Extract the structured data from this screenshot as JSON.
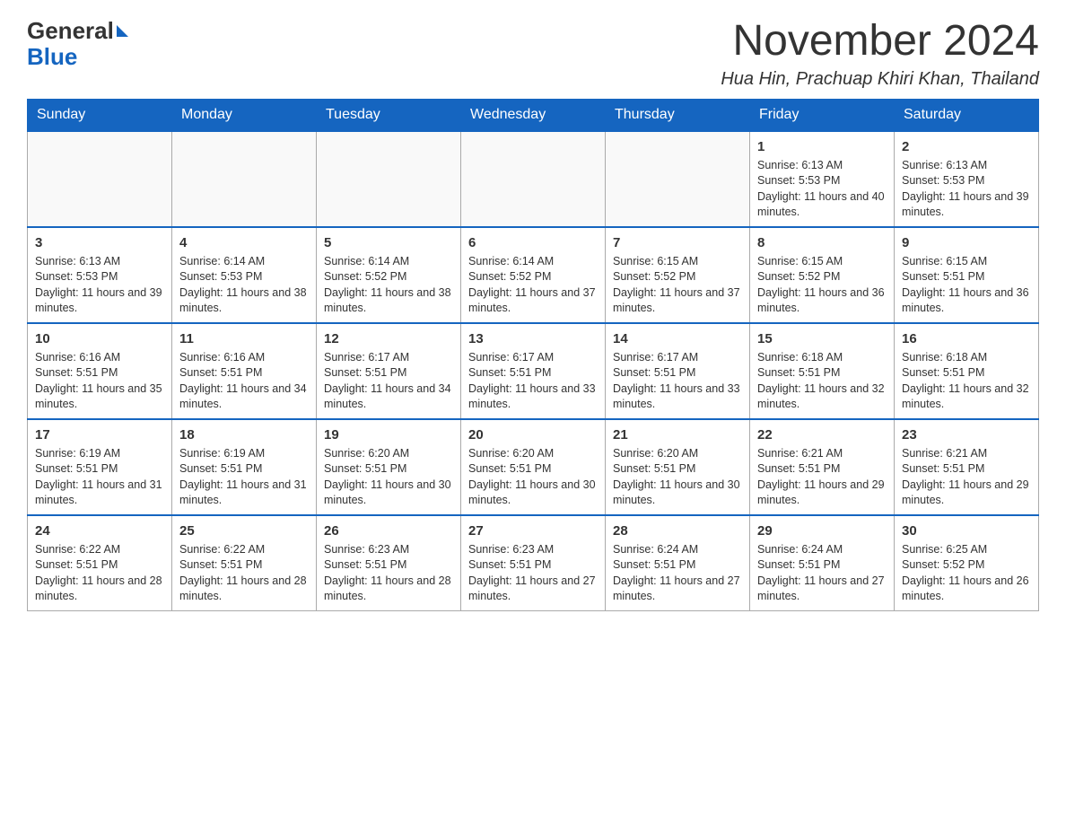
{
  "header": {
    "logo": {
      "general_text": "General",
      "blue_text": "Blue"
    },
    "month_year": "November 2024",
    "location": "Hua Hin, Prachuap Khiri Khan, Thailand"
  },
  "days_of_week": [
    "Sunday",
    "Monday",
    "Tuesday",
    "Wednesday",
    "Thursday",
    "Friday",
    "Saturday"
  ],
  "weeks": [
    {
      "days": [
        {
          "number": "",
          "info": ""
        },
        {
          "number": "",
          "info": ""
        },
        {
          "number": "",
          "info": ""
        },
        {
          "number": "",
          "info": ""
        },
        {
          "number": "",
          "info": ""
        },
        {
          "number": "1",
          "info": "Sunrise: 6:13 AM\nSunset: 5:53 PM\nDaylight: 11 hours and 40 minutes."
        },
        {
          "number": "2",
          "info": "Sunrise: 6:13 AM\nSunset: 5:53 PM\nDaylight: 11 hours and 39 minutes."
        }
      ]
    },
    {
      "days": [
        {
          "number": "3",
          "info": "Sunrise: 6:13 AM\nSunset: 5:53 PM\nDaylight: 11 hours and 39 minutes."
        },
        {
          "number": "4",
          "info": "Sunrise: 6:14 AM\nSunset: 5:53 PM\nDaylight: 11 hours and 38 minutes."
        },
        {
          "number": "5",
          "info": "Sunrise: 6:14 AM\nSunset: 5:52 PM\nDaylight: 11 hours and 38 minutes."
        },
        {
          "number": "6",
          "info": "Sunrise: 6:14 AM\nSunset: 5:52 PM\nDaylight: 11 hours and 37 minutes."
        },
        {
          "number": "7",
          "info": "Sunrise: 6:15 AM\nSunset: 5:52 PM\nDaylight: 11 hours and 37 minutes."
        },
        {
          "number": "8",
          "info": "Sunrise: 6:15 AM\nSunset: 5:52 PM\nDaylight: 11 hours and 36 minutes."
        },
        {
          "number": "9",
          "info": "Sunrise: 6:15 AM\nSunset: 5:51 PM\nDaylight: 11 hours and 36 minutes."
        }
      ]
    },
    {
      "days": [
        {
          "number": "10",
          "info": "Sunrise: 6:16 AM\nSunset: 5:51 PM\nDaylight: 11 hours and 35 minutes."
        },
        {
          "number": "11",
          "info": "Sunrise: 6:16 AM\nSunset: 5:51 PM\nDaylight: 11 hours and 34 minutes."
        },
        {
          "number": "12",
          "info": "Sunrise: 6:17 AM\nSunset: 5:51 PM\nDaylight: 11 hours and 34 minutes."
        },
        {
          "number": "13",
          "info": "Sunrise: 6:17 AM\nSunset: 5:51 PM\nDaylight: 11 hours and 33 minutes."
        },
        {
          "number": "14",
          "info": "Sunrise: 6:17 AM\nSunset: 5:51 PM\nDaylight: 11 hours and 33 minutes."
        },
        {
          "number": "15",
          "info": "Sunrise: 6:18 AM\nSunset: 5:51 PM\nDaylight: 11 hours and 32 minutes."
        },
        {
          "number": "16",
          "info": "Sunrise: 6:18 AM\nSunset: 5:51 PM\nDaylight: 11 hours and 32 minutes."
        }
      ]
    },
    {
      "days": [
        {
          "number": "17",
          "info": "Sunrise: 6:19 AM\nSunset: 5:51 PM\nDaylight: 11 hours and 31 minutes."
        },
        {
          "number": "18",
          "info": "Sunrise: 6:19 AM\nSunset: 5:51 PM\nDaylight: 11 hours and 31 minutes."
        },
        {
          "number": "19",
          "info": "Sunrise: 6:20 AM\nSunset: 5:51 PM\nDaylight: 11 hours and 30 minutes."
        },
        {
          "number": "20",
          "info": "Sunrise: 6:20 AM\nSunset: 5:51 PM\nDaylight: 11 hours and 30 minutes."
        },
        {
          "number": "21",
          "info": "Sunrise: 6:20 AM\nSunset: 5:51 PM\nDaylight: 11 hours and 30 minutes."
        },
        {
          "number": "22",
          "info": "Sunrise: 6:21 AM\nSunset: 5:51 PM\nDaylight: 11 hours and 29 minutes."
        },
        {
          "number": "23",
          "info": "Sunrise: 6:21 AM\nSunset: 5:51 PM\nDaylight: 11 hours and 29 minutes."
        }
      ]
    },
    {
      "days": [
        {
          "number": "24",
          "info": "Sunrise: 6:22 AM\nSunset: 5:51 PM\nDaylight: 11 hours and 28 minutes."
        },
        {
          "number": "25",
          "info": "Sunrise: 6:22 AM\nSunset: 5:51 PM\nDaylight: 11 hours and 28 minutes."
        },
        {
          "number": "26",
          "info": "Sunrise: 6:23 AM\nSunset: 5:51 PM\nDaylight: 11 hours and 28 minutes."
        },
        {
          "number": "27",
          "info": "Sunrise: 6:23 AM\nSunset: 5:51 PM\nDaylight: 11 hours and 27 minutes."
        },
        {
          "number": "28",
          "info": "Sunrise: 6:24 AM\nSunset: 5:51 PM\nDaylight: 11 hours and 27 minutes."
        },
        {
          "number": "29",
          "info": "Sunrise: 6:24 AM\nSunset: 5:51 PM\nDaylight: 11 hours and 27 minutes."
        },
        {
          "number": "30",
          "info": "Sunrise: 6:25 AM\nSunset: 5:52 PM\nDaylight: 11 hours and 26 minutes."
        }
      ]
    }
  ]
}
